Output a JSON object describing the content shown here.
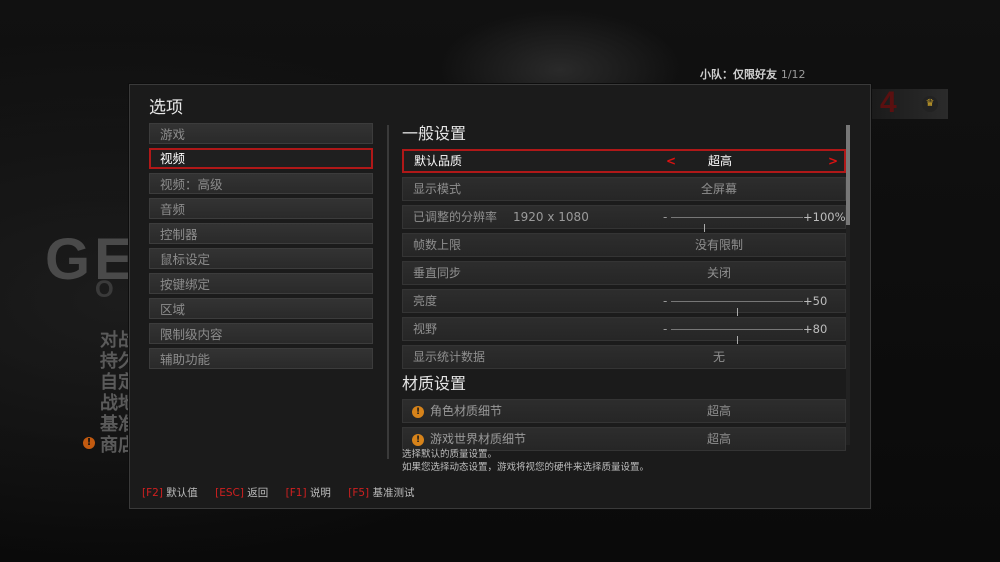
{
  "background": {
    "logo_text": "GE",
    "logo_sub": "O",
    "menu_items": [
      "对战",
      "持久",
      "自定",
      "战地",
      "基准",
      "商店"
    ],
    "warn_glyph": "!",
    "emblem_num": "4",
    "crown_glyph": "♛"
  },
  "squad": {
    "label": "小队：仅限好友",
    "count": "1/12"
  },
  "dialog": {
    "title": "选项",
    "nav": [
      {
        "label": "游戏"
      },
      {
        "label": "视频"
      },
      {
        "label": "视频：高级"
      },
      {
        "label": "音频"
      },
      {
        "label": "控制器"
      },
      {
        "label": "鼠标设定"
      },
      {
        "label": "按键绑定"
      },
      {
        "label": "区域"
      },
      {
        "label": "限制级内容"
      },
      {
        "label": "辅助功能"
      }
    ],
    "active_nav": "视频",
    "general": {
      "title": "一般设置",
      "rows": [
        {
          "label": "默认品质",
          "value": "超高",
          "left_arrow": "<",
          "right_arrow": ">"
        },
        {
          "label": "显示模式",
          "value": "全屏幕"
        },
        {
          "label": "已调整的分辨率",
          "extra": "1920 x 1080",
          "slider_value": "+100%",
          "minus": "-",
          "fraction": 0.25
        },
        {
          "label": "帧数上限",
          "value": "没有限制"
        },
        {
          "label": "垂直同步",
          "value": "关闭"
        },
        {
          "label": "亮度",
          "slider_value": "+50",
          "minus": "-",
          "fraction": 0.5
        },
        {
          "label": "视野",
          "slider_value": "+80",
          "minus": "-",
          "fraction": 0.5
        },
        {
          "label": "显示统计数据",
          "value": "无"
        }
      ]
    },
    "texture": {
      "title": "材质设置",
      "warn_glyph": "!",
      "rows": [
        {
          "label": "角色材质细节",
          "value": "超高"
        },
        {
          "label": "游戏世界材质细节",
          "value": "超高"
        }
      ]
    },
    "description": {
      "line1": "选择默认的质量设置。",
      "line2": "如果您选择动态设置，游戏将视您的硬件来选择质量设置。"
    },
    "footer": [
      {
        "key": "[F2]",
        "label": "默认值"
      },
      {
        "key": "[ESC]",
        "label": "返回"
      },
      {
        "key": "[F1]",
        "label": "说明"
      },
      {
        "key": "[F5]",
        "label": "基准测试"
      }
    ]
  },
  "colors": {
    "accent": "#b01818",
    "warn": "#d7831a"
  }
}
